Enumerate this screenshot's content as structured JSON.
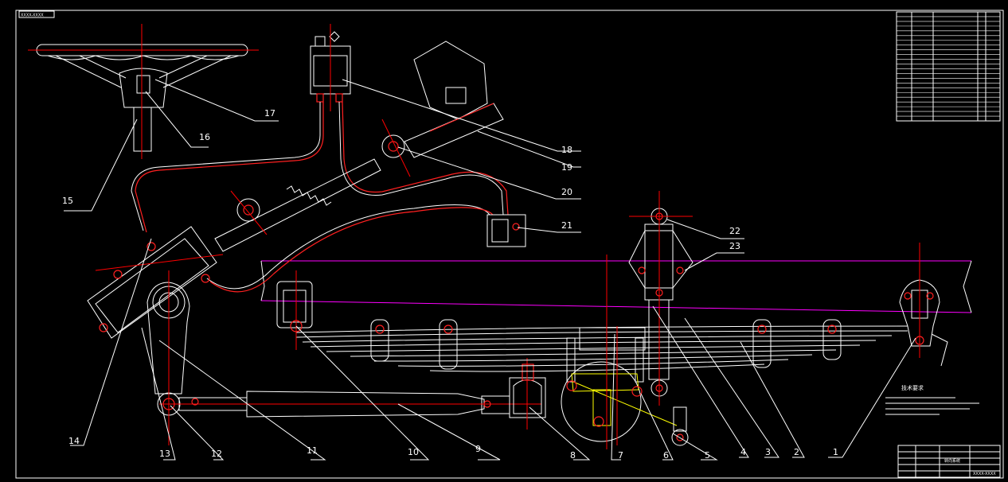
{
  "drawing": {
    "top_stamp": "XXXX-XXXX",
    "bottom_stamp": "XXXX-XXXX",
    "title_block_text": "转向系统"
  },
  "callouts": [
    {
      "id": "1",
      "text": "1"
    },
    {
      "id": "2",
      "text": "2"
    },
    {
      "id": "3",
      "text": "3"
    },
    {
      "id": "4",
      "text": "4"
    },
    {
      "id": "5",
      "text": "5"
    },
    {
      "id": "6",
      "text": "6"
    },
    {
      "id": "7",
      "text": "7"
    },
    {
      "id": "8",
      "text": "8"
    },
    {
      "id": "9",
      "text": "9"
    },
    {
      "id": "10",
      "text": "10"
    },
    {
      "id": "11",
      "text": "11"
    },
    {
      "id": "12",
      "text": "12"
    },
    {
      "id": "13",
      "text": "13"
    },
    {
      "id": "14",
      "text": "14"
    },
    {
      "id": "15",
      "text": "15"
    },
    {
      "id": "16",
      "text": "16"
    },
    {
      "id": "17",
      "text": "17"
    },
    {
      "id": "18",
      "text": "18"
    },
    {
      "id": "19",
      "text": "19"
    },
    {
      "id": "20",
      "text": "20"
    },
    {
      "id": "21",
      "text": "21"
    },
    {
      "id": "22",
      "text": "22"
    },
    {
      "id": "23",
      "text": "23"
    }
  ],
  "tech_notes": {
    "title": "技术要求"
  },
  "colors": {
    "background": "#000000",
    "outline": "#ffffff",
    "centerline": "#ff0000",
    "frame_rail": "#ff00ff",
    "highlight": "#ffff00"
  }
}
